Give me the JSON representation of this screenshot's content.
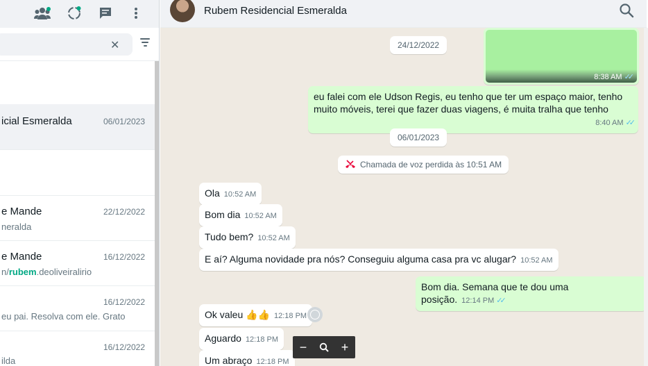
{
  "left_panel": {
    "header_icons": [
      "communities-icon",
      "status-icon",
      "new-chat-icon",
      "menu-icon"
    ],
    "search": {
      "placeholder": ""
    },
    "chats": [
      {
        "name": "icial Esmeralda",
        "date": "06/01/2023",
        "preview": ""
      },
      {
        "name": "e Mande",
        "date": "22/12/2022",
        "preview": "neralda"
      },
      {
        "name": "e Mande",
        "date": "16/12/2022",
        "preview_pre": "n/",
        "preview_bold": "rubem",
        "preview_post": ".deoliveiralirio"
      },
      {
        "name": "",
        "date": "16/12/2022",
        "preview": "eu pai. Resolva com ele. Grato"
      },
      {
        "name": "",
        "date": "16/12/2022",
        "preview": "ilda"
      }
    ]
  },
  "chat": {
    "contact_name": "Rubem Residencial Esmeralda",
    "date_1": "24/12/2022",
    "image_time": "8:38 AM",
    "msg_out_1": "eu falei com ele Udson Regis, eu tenho que ter um espaço maior, tenho muito móveis, terei que fazer duas viagens, é muita tralha que tenho",
    "msg_out_1_time": "8:40 AM",
    "date_2": "06/01/2023",
    "missed_call": "Chamada de voz perdida às 10:51 AM",
    "msgs_in": [
      {
        "text": "Ola",
        "time": "10:52 AM"
      },
      {
        "text": "Bom dia",
        "time": "10:52 AM"
      },
      {
        "text": "Tudo bem?",
        "time": "10:52 AM"
      },
      {
        "text": "E aí? Alguma novidade pra nós? Conseguiu alguma casa pra vc alugar?",
        "time": "10:52 AM"
      }
    ],
    "msg_out_2": "Bom dia. Semana que te dou uma posição.",
    "msg_out_2_time": "12:14 PM",
    "msgs_in_2": [
      {
        "text": "Ok valeu 👍👍",
        "time": "12:18 PM"
      },
      {
        "text": "Aguardo",
        "time": "12:18 PM"
      },
      {
        "text": "Um abraço",
        "time": "12:18 PM"
      }
    ]
  },
  "colors": {
    "header_bg": "#f0f2f5",
    "chat_bg": "#efeae2",
    "outgoing_bubble": "#d9fdd3",
    "incoming_bubble": "#ffffff",
    "read_ticks": "#53bdeb",
    "missed_call_red": "#ea0038"
  }
}
